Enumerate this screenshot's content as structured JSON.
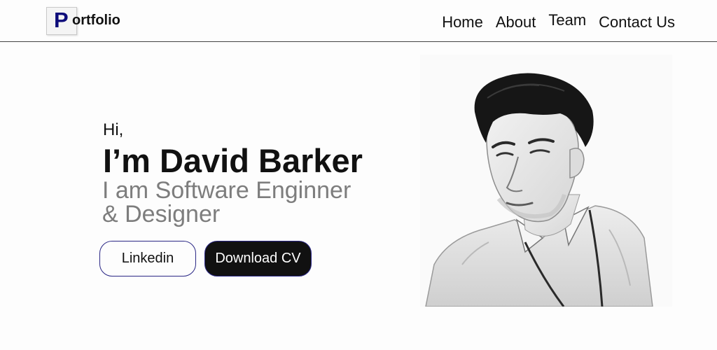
{
  "header": {
    "logo_letter": "P",
    "logo_text": "ortfolio",
    "nav": [
      "Home",
      "About",
      "Team",
      "Contact Us"
    ]
  },
  "hero": {
    "greeting": "Hi,",
    "name": "I’m David Barker",
    "role_line1": "I am Software Enginner",
    "role_line2": "& Designer",
    "buttons": {
      "linkedin": "Linkedin",
      "download_cv": "Download CV"
    }
  },
  "colors": {
    "logo_blue": "#0d0c7a",
    "button_border": "#2a2785",
    "role_gray": "#7d7d7d"
  }
}
